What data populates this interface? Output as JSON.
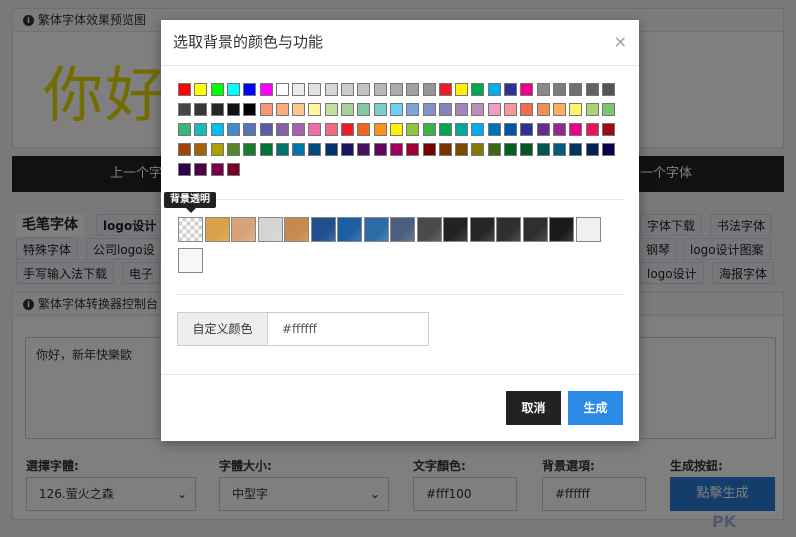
{
  "bg": {
    "preview_title": "繁体字体效果预览图",
    "preview_text": "你好",
    "nav_prev": "上一个字",
    "nav_next": "一个字体",
    "tags": [
      "毛笔字体",
      "logo设计",
      "字体下载",
      "书法字体",
      "特殊字体",
      "公司logo设",
      "钢琴",
      "logo设计图案",
      "手写输入法下载",
      "电子",
      "logo设计",
      "海报字体"
    ],
    "control_title": "繁体字体转换器控制台",
    "textarea_value": "你好，新年快樂歐",
    "labels": {
      "font": "選擇字體:",
      "size": "字體大小:",
      "color": "文字顏色:",
      "bg": "背景選項:",
      "gen": "生成按鈕:"
    },
    "values": {
      "font": "126.萤火之森",
      "size": "中型字",
      "color": "#fff100",
      "bg": "#ffffff"
    },
    "gen_button": "點擊生成",
    "logo": "PK"
  },
  "modal": {
    "title": "选取背景的颜色与功能",
    "close": "×",
    "tooltip": "背景透明",
    "custom_label": "自定义颜色",
    "custom_value": "#ffffff",
    "cancel": "取消",
    "generate": "生成"
  },
  "colors": {
    "row1": [
      "#ff0000",
      "#ffff00",
      "#00ff00",
      "#00ffff",
      "#0000ff",
      "#ff00ff",
      "#ffffff",
      "#ebebeb",
      "#e1e1e1",
      "#d7d7d7",
      "#cccccc",
      "#c2c2c2",
      "#b7b7b7",
      "#acacac",
      "#a0a0a0",
      "#959595",
      "#ee1d24",
      "#fff100",
      "#00a650",
      "#00aeef",
      "#2f3192",
      "#ed008c",
      "#898989",
      "#7d7d7d",
      "#707070",
      "#626262",
      "#555555"
    ],
    "row2": [
      "#464646",
      "#363636",
      "#262626",
      "#111111",
      "#000000",
      "#f7977a",
      "#fbad82",
      "#fdc68c",
      "#fff799",
      "#c6df9c",
      "#a4d49d",
      "#81ca9d",
      "#7bcdc9",
      "#6ccff7",
      "#7ca6d8",
      "#8293ca",
      "#8881be",
      "#a286bd",
      "#bc8cbf",
      "#f49bc1",
      "#f5999d",
      "#f16c4d",
      "#f68e54",
      "#fbaf5a",
      "#fff467",
      "#acd372",
      "#7dc473"
    ],
    "row3": [
      "#39b778",
      "#16bcb4",
      "#00bff3",
      "#438ccb",
      "#5573b7",
      "#5e5ca7",
      "#855fa8",
      "#a763a9",
      "#ef6ea8",
      "#f16d7e",
      "#ee1d24",
      "#f16522",
      "#f7941d",
      "#fff100",
      "#8fc63d",
      "#37b44a",
      "#00a650",
      "#00a99e",
      "#00aeef",
      "#0072bc",
      "#0054a5",
      "#2f3192",
      "#652c91",
      "#91278f",
      "#ed008c",
      "#ee105a",
      "#9d0a0f"
    ],
    "row4": [
      "#a1410d",
      "#a36209",
      "#aba000",
      "#588528",
      "#197b30",
      "#007236",
      "#00736a",
      "#0076a4",
      "#004a80",
      "#003370",
      "#1d1363",
      "#450e61",
      "#62055f",
      "#9e005c",
      "#9d0039",
      "#790000",
      "#7b3000",
      "#7c4900",
      "#827a00",
      "#3e6617",
      "#045f20",
      "#005824",
      "#005951",
      "#005b7e",
      "#003562",
      "#002056",
      "#0c004b"
    ],
    "row5": [
      "#30004a",
      "#4b0048",
      "#7a0045",
      "#7a0026"
    ],
    "textures": [
      "#e8e8e8",
      "#d9a24a",
      "#d9a37a",
      "#d4d4d4",
      "#c78a4e",
      "#1f4f8f",
      "#1e5fa3",
      "#2c6aa8",
      "#4a5f7f",
      "#4a4a4a",
      "#222222",
      "#262626",
      "#2e2e2e",
      "#303030",
      "#1a1a1a",
      "#f0f0f0",
      "#f7f7f7"
    ]
  }
}
